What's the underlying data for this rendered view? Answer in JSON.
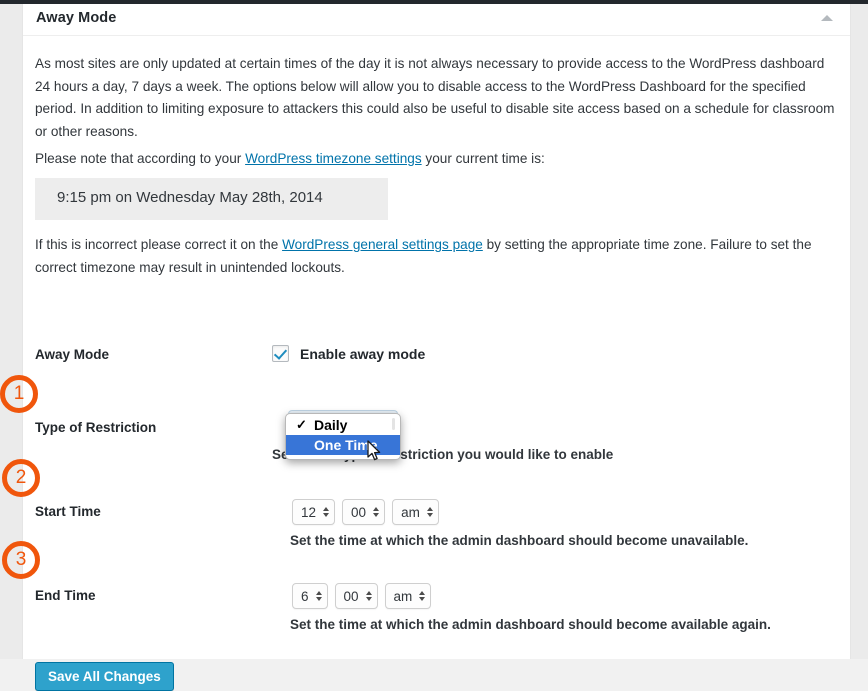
{
  "panel": {
    "title": "Away Mode",
    "collapse_icon": "triangle-up-icon",
    "intro_paragraph": "As most sites are only updated at certain times of the day it is not always necessary to provide access to the WordPress dashboard 24 hours a day, 7 days a week. The options below will allow you to disable access to the WordPress Dashboard for the specified period. In addition to limiting exposure to attackers this could also be useful to disable site access based on a schedule for classroom or other reasons.",
    "note_prefix": "Please note that according to your ",
    "note_link": "WordPress timezone settings",
    "note_suffix": " your current time is:",
    "current_time": "9:15 pm on Wednesday May 28th, 2014",
    "correct_prefix": "If this is incorrect please correct it on the ",
    "correct_link": "WordPress general settings page",
    "correct_suffix": " by setting the appropriate time zone. Failure to set the correct timezone may result in unintended lockouts."
  },
  "form": {
    "away_mode": {
      "label": "Away Mode",
      "checkbox_label": "Enable away mode",
      "checked": true
    },
    "type_of_restriction": {
      "label": "Type of Restriction",
      "description": "Select the type of restriction you would like to enable",
      "open": true,
      "options": [
        {
          "label": "Daily",
          "checked": true,
          "highlighted": false
        },
        {
          "label": "One Time",
          "checked": false,
          "highlighted": true
        }
      ],
      "checkmark": "✓"
    },
    "start_time": {
      "label": "Start Time",
      "description": "Set the time at which the admin dashboard should become unavailable.",
      "hour": "12",
      "minute": "00",
      "meridiem": "am"
    },
    "end_time": {
      "label": "End Time",
      "description": "Set the time at which the admin dashboard should become available again.",
      "hour": "6",
      "minute": "00",
      "meridiem": "am"
    },
    "save_label": "Save All Changes"
  },
  "annotations": {
    "badges": [
      "1",
      "2",
      "3"
    ],
    "color": "#f0560c"
  },
  "colors": {
    "link": "#0073aa",
    "accent_button": "#2ea2cc",
    "select_highlight": "#3875d7",
    "checkbox_check": "#1e8cbe",
    "page_background": "#f1f1f1",
    "panel_background": "#ffffff",
    "timebox_background": "#ededed"
  }
}
